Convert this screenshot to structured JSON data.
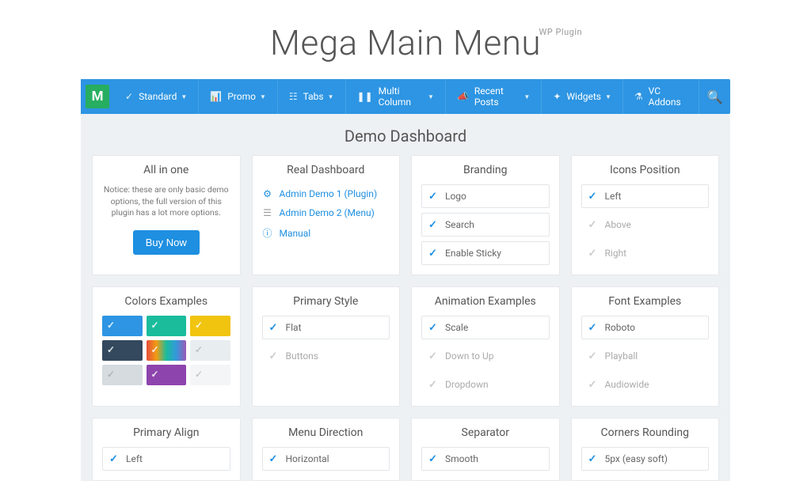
{
  "hero": {
    "title": "Mega Main Menu",
    "sup": "WP Plugin"
  },
  "nav": {
    "logo": "M",
    "items": [
      {
        "label": "Standard"
      },
      {
        "label": "Promo"
      },
      {
        "label": "Tabs"
      },
      {
        "label": "Multi Column"
      },
      {
        "label": "Recent Posts"
      },
      {
        "label": "Widgets"
      },
      {
        "label": "VC Addons"
      }
    ]
  },
  "dash": {
    "title": "Demo Dashboard"
  },
  "cards": {
    "allinone": {
      "title": "All in one",
      "notice": "Notice: these are only basic demo options, the full version of this plugin has a lot more options.",
      "buy": "Buy Now"
    },
    "real": {
      "title": "Real Dashboard",
      "links": [
        {
          "label": "Admin Demo 1 (Plugin)"
        },
        {
          "label": "Admin Demo 2 (Menu)"
        },
        {
          "label": "Manual"
        }
      ]
    },
    "branding": {
      "title": "Branding",
      "opts": [
        "Logo",
        "Search",
        "Enable Sticky"
      ]
    },
    "icons": {
      "title": "Icons Position",
      "opts": [
        "Left",
        "Above",
        "Right"
      ]
    },
    "colors": {
      "title": "Colors Examples"
    },
    "primary_style": {
      "title": "Primary Style",
      "opts": [
        "Flat",
        "Buttons"
      ]
    },
    "anim": {
      "title": "Animation Examples",
      "opts": [
        "Scale",
        "Down to Up",
        "Dropdown"
      ]
    },
    "font": {
      "title": "Font Examples",
      "opts": [
        "Roboto",
        "Playball",
        "Audiowide"
      ]
    },
    "align": {
      "title": "Primary Align",
      "opts": [
        "Left"
      ]
    },
    "direction": {
      "title": "Menu Direction",
      "opts": [
        "Horizontal"
      ]
    },
    "separator": {
      "title": "Separator",
      "opts": [
        "Smooth"
      ]
    },
    "corners": {
      "title": "Corners Rounding",
      "opts": [
        "5px (easy soft)"
      ]
    }
  }
}
